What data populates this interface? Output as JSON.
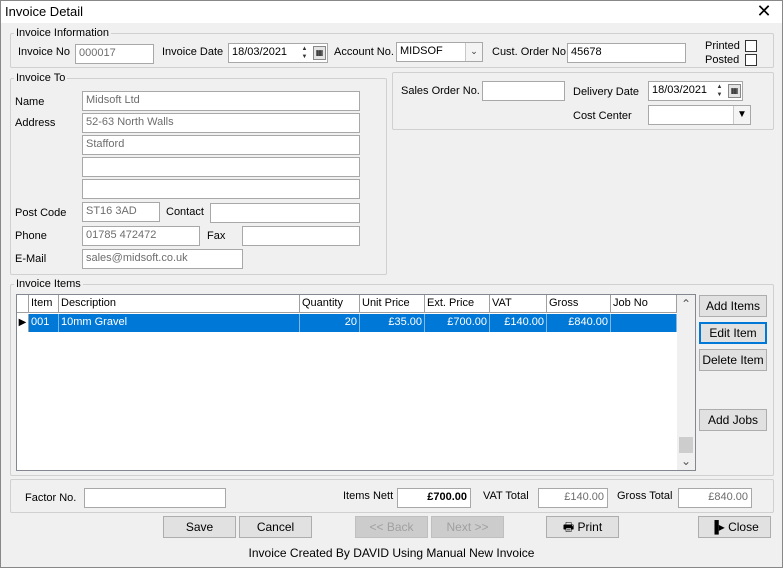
{
  "window": {
    "title": "Invoice Detail"
  },
  "invoice_info": {
    "legend": "Invoice Information",
    "invoice_no_label": "Invoice No",
    "invoice_no": "000017",
    "invoice_date_label": "Invoice Date",
    "invoice_date": "18/03/2021",
    "account_no_label": "Account No.",
    "account_no": "MIDSOF",
    "cust_order_label": "Cust. Order No.",
    "cust_order_no": "45678",
    "printed_label": "Printed",
    "posted_label": "Posted"
  },
  "invoice_to": {
    "legend": "Invoice To",
    "name_label": "Name",
    "name": "Midsoft Ltd",
    "address_label": "Address",
    "address1": "52-63 North Walls",
    "address2": "Stafford",
    "address3": "",
    "address4": "",
    "postcode_label": "Post Code",
    "postcode": "ST16 3AD",
    "contact_label": "Contact",
    "contact": "",
    "phone_label": "Phone",
    "phone": "01785 472472",
    "fax_label": "Fax",
    "fax": "",
    "email_label": "E-Mail",
    "email": "sales@midsoft.co.uk"
  },
  "order": {
    "sales_order_label": "Sales Order No.",
    "sales_order_no": "",
    "delivery_date_label": "Delivery Date",
    "delivery_date": "18/03/2021",
    "cost_center_label": "Cost Center",
    "cost_center": ""
  },
  "items": {
    "legend": "Invoice Items",
    "columns": [
      "Item",
      "Description",
      "Quantity",
      "Unit Price",
      "Ext. Price",
      "VAT",
      "Gross",
      "Job No"
    ],
    "rows": [
      {
        "item": "001",
        "description": "10mm Gravel",
        "quantity": "20",
        "unit_price": "£35.00",
        "ext_price": "£700.00",
        "vat": "£140.00",
        "gross": "£840.00",
        "job_no": ""
      }
    ],
    "add_items": "Add Items",
    "edit_item": "Edit Item",
    "delete_item": "Delete Item",
    "add_jobs": "Add Jobs"
  },
  "totals": {
    "factor_label": "Factor No.",
    "factor_no": "",
    "nett_label": "Items Nett",
    "nett": "£700.00",
    "vat_label": "VAT Total",
    "vat": "£140.00",
    "gross_label": "Gross Total",
    "gross": "£840.00"
  },
  "buttons": {
    "save": "Save",
    "cancel": "Cancel",
    "back": "<< Back",
    "next": "Next >>",
    "print": "Print",
    "close": "Close"
  },
  "status": "Invoice Created By DAVID Using Manual New Invoice",
  "colors": {
    "selection": "#0078d7",
    "background": "#f0f0f0"
  }
}
